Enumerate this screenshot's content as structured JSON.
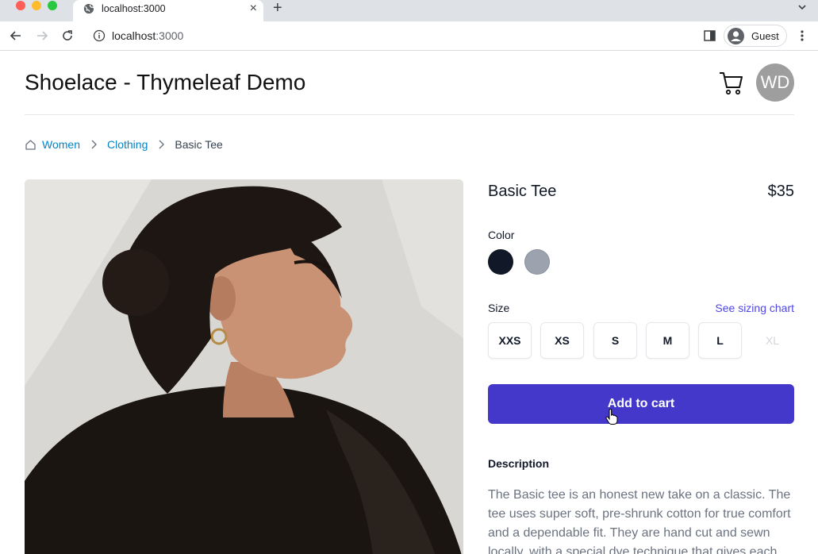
{
  "browser": {
    "tab_title": "localhost:3000",
    "tab_close": "×",
    "new_tab": "+",
    "url_host": "localhost",
    "url_port": ":3000",
    "profile_name": "Guest"
  },
  "header": {
    "site_title": "Shoelace - Thymeleaf Demo",
    "avatar_initials": "WD"
  },
  "breadcrumb": {
    "items": [
      "Women",
      "Clothing"
    ],
    "current": "Basic Tee"
  },
  "product": {
    "name": "Basic Tee",
    "price": "$35",
    "color_label": "Color",
    "colors": [
      "#111827",
      "#9ca3af"
    ],
    "size_label": "Size",
    "size_chart_link": "See sizing chart",
    "sizes": [
      "XXS",
      "XS",
      "S",
      "M",
      "L",
      "XL"
    ],
    "add_to_cart": "Add to cart",
    "description_label": "Description",
    "description": "The Basic tee is an honest new take on a classic. The tee uses super soft, pre-shrunk cotton for true comfort and a dependable fit. They are hand cut and sewn locally, with a special dye technique that gives each tee it's own look."
  },
  "colors": {
    "accent": "#4338ca",
    "link": "#0284c7",
    "size_chart_link": "#4f46e5",
    "avatar_bg": "#9e9e9e"
  }
}
